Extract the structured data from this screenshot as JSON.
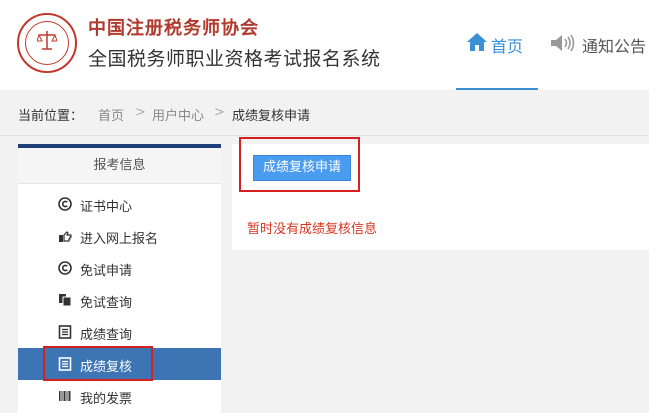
{
  "header": {
    "brand": "中国注册税务师协会",
    "system_title": "全国税务师职业资格考试报名系统"
  },
  "nav": {
    "home_label": "首页",
    "notice_label": "通知公告"
  },
  "breadcrumb": {
    "prefix": "当前位置：",
    "items": [
      "首页",
      "用户中心",
      "成绩复核申请"
    ],
    "separator": ">"
  },
  "sidebar": {
    "heading": "报考信息",
    "items": [
      {
        "label": "证书中心",
        "icon": "copyright-icon"
      },
      {
        "label": "进入网上报名",
        "icon": "hand-pointer-icon"
      },
      {
        "label": "免试申请",
        "icon": "copyright-icon"
      },
      {
        "label": "免试查询",
        "icon": "copy-files-icon"
      },
      {
        "label": "成绩查询",
        "icon": "list-doc-icon"
      },
      {
        "label": "成绩复核",
        "icon": "list-doc-icon",
        "active": true
      },
      {
        "label": "我的发票",
        "icon": "barcode-icon"
      }
    ]
  },
  "main": {
    "apply_button": "成绩复核申请",
    "empty_message": "暂时没有成绩复核信息"
  },
  "colors": {
    "accent": "#3b8fd4",
    "active_item": "#3d74b4",
    "button": "#4a9cf0",
    "error_text": "#d9331f",
    "highlight_box": "#d62020",
    "brand_red": "#b03a2e"
  }
}
